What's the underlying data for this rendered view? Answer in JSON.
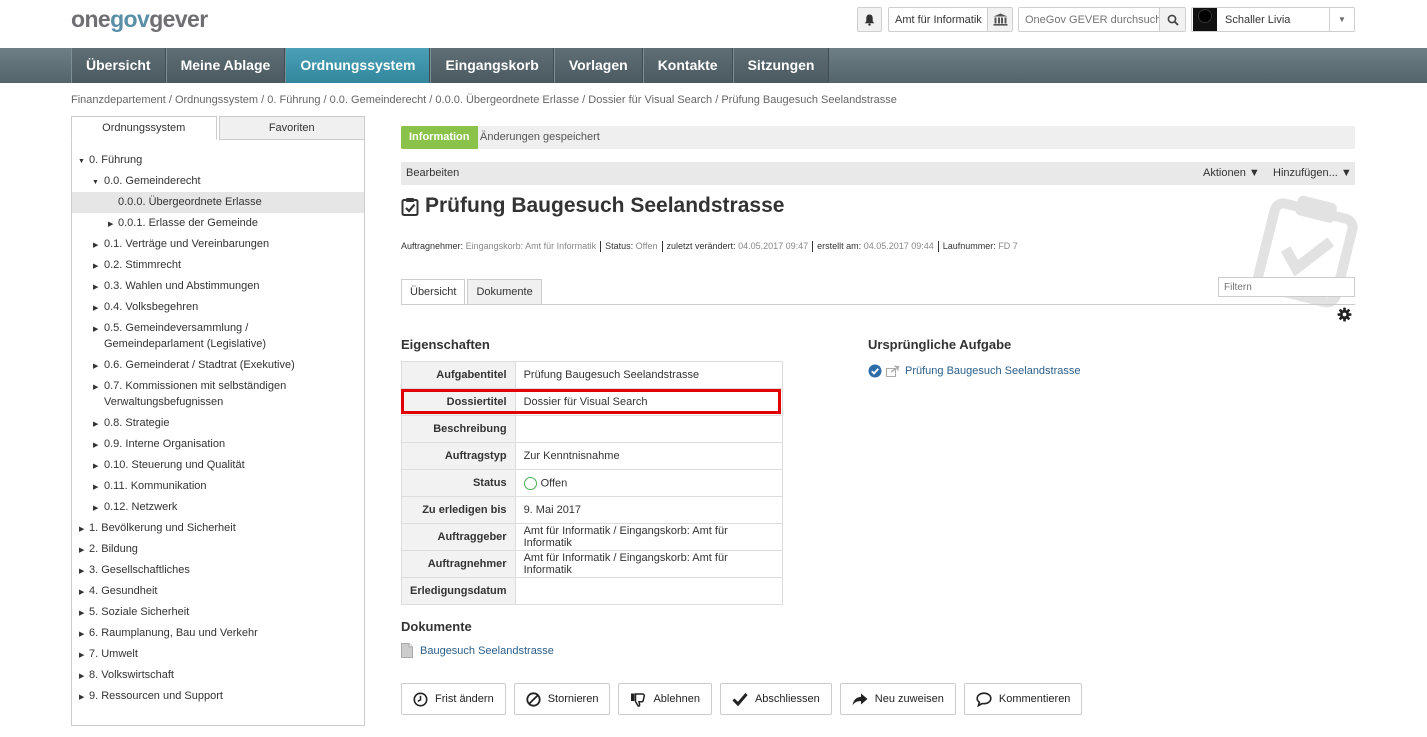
{
  "header": {
    "logo": "onegovgever",
    "org_label": "Amt für Informatik",
    "search_placeholder": "OneGov GEVER durchsuchen",
    "user": "Schaller Livia"
  },
  "nav": [
    "Übersicht",
    "Meine Ablage",
    "Ordnungssystem",
    "Eingangskorb",
    "Vorlagen",
    "Kontakte",
    "Sitzungen"
  ],
  "breadcrumb": "Finanzdepartement / Ordnungssystem / 0. Führung / 0.0. Gemeinderecht / 0.0.0. Übergeordnete Erlasse / Dossier für Visual Search / Prüfung Baugesuch Seelandstrasse",
  "sidebar": {
    "tabs": [
      "Ordnungssystem",
      "Favoriten"
    ],
    "tree": [
      {
        "label": "0. Führung"
      },
      {
        "label": "0.0. Gemeinderecht"
      },
      {
        "label": "0.0.0. Übergeordnete Erlasse"
      },
      {
        "label": "0.0.1. Erlasse der Gemeinde"
      },
      {
        "label": "0.1. Verträge und Vereinbarungen"
      },
      {
        "label": "0.2. Stimmrecht"
      },
      {
        "label": "0.3. Wahlen und Abstimmungen"
      },
      {
        "label": "0.4. Volksbegehren"
      },
      {
        "label": "0.5. Gemeindeversammlung / Gemeindeparlament (Legislative)"
      },
      {
        "label": "0.6. Gemeinderat / Stadtrat (Exekutive)"
      },
      {
        "label": "0.7. Kommissionen mit selbständigen Verwaltungsbefugnissen"
      },
      {
        "label": "0.8. Strategie"
      },
      {
        "label": "0.9. Interne Organisation"
      },
      {
        "label": "0.10. Steuerung und Qualität"
      },
      {
        "label": "0.11. Kommunikation"
      },
      {
        "label": "0.12. Netzwerk"
      },
      {
        "label": "1. Bevölkerung und Sicherheit"
      },
      {
        "label": "2. Bildung"
      },
      {
        "label": "3. Gesellschaftliches"
      },
      {
        "label": "4. Gesundheit"
      },
      {
        "label": "5. Soziale Sicherheit"
      },
      {
        "label": "6. Raumplanung, Bau und Verkehr"
      },
      {
        "label": "7. Umwelt"
      },
      {
        "label": "8. Volkswirtschaft"
      },
      {
        "label": "9. Ressourcen und Support"
      }
    ]
  },
  "info": {
    "badge": "Information",
    "message": "Änderungen gespeichert"
  },
  "actions": {
    "edit": "Bearbeiten",
    "actions": "Aktionen ▼",
    "add": "Hinzufügen... ▼"
  },
  "title": "Prüfung Baugesuch Seelandstrasse",
  "meta": {
    "assignee_label": "Auftragnehmer:",
    "assignee": "Eingangskorb: Amt für Informatik",
    "status_label": "Status:",
    "status": "Offen",
    "modified_label": "zuletzt verändert:",
    "modified": "04.05.2017 09:47",
    "created_label": "erstellt am:",
    "created": "04.05.2017 09:44",
    "seq_label": "Laufnummer:",
    "seq": "FD 7"
  },
  "content_tabs": [
    "Übersicht",
    "Dokumente"
  ],
  "filter_placeholder": "Filtern",
  "properties": {
    "heading": "Eigenschaften",
    "rows": [
      {
        "k": "Aufgabentitel",
        "v": "Prüfung Baugesuch Seelandstrasse"
      },
      {
        "k": "Dossiertitel",
        "v": "Dossier für Visual Search"
      },
      {
        "k": "Beschreibung",
        "v": ""
      },
      {
        "k": "Auftragstyp",
        "v": "Zur Kenntnisnahme"
      },
      {
        "k": "Status",
        "v": "Offen"
      },
      {
        "k": "Zu erledigen bis",
        "v": "9. Mai 2017"
      },
      {
        "k": "Auftraggeber",
        "v": "Amt für Informatik / Eingangskorb: Amt für Informatik"
      },
      {
        "k": "Auftragnehmer",
        "v": "Amt für Informatik / Eingangskorb: Amt für Informatik"
      },
      {
        "k": "Erledigungsdatum",
        "v": ""
      }
    ]
  },
  "original_task": {
    "heading": "Ursprüngliche Aufgabe",
    "link": "Prüfung Baugesuch Seelandstrasse"
  },
  "documents": {
    "heading": "Dokumente",
    "link": "Baugesuch Seelandstrasse"
  },
  "buttons": {
    "deadline": "Frist ändern",
    "cancel": "Stornieren",
    "reject": "Ablehnen",
    "close": "Abschliessen",
    "reassign": "Neu zuweisen",
    "comment": "Kommentieren"
  },
  "colors": {
    "nav_active": "#3a92a8",
    "info_badge": "#8bc34a",
    "highlight": "#e00000",
    "link": "#2a5f8a"
  }
}
